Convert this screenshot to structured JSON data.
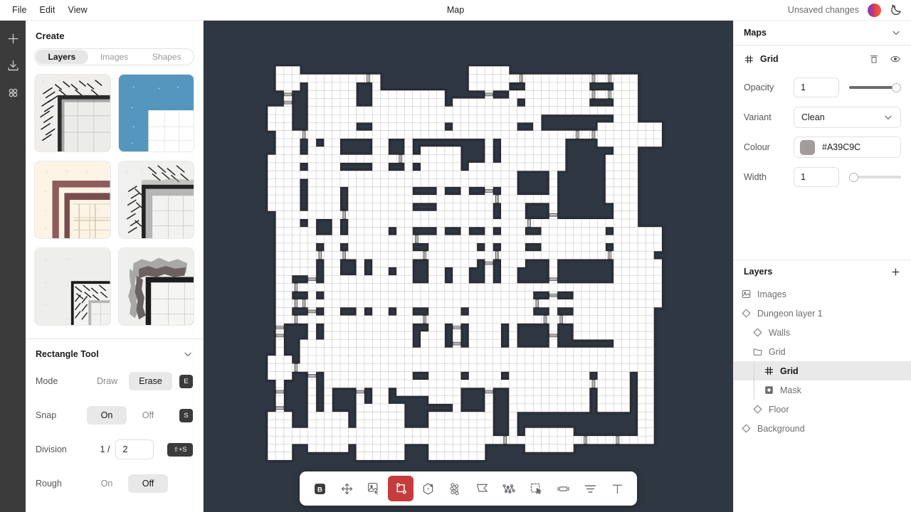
{
  "window": {
    "title": "Map",
    "menu": [
      "File",
      "Edit",
      "View"
    ],
    "status": "Unsaved changes",
    "avatar_name": "user-avatar",
    "theme_icon": "moon-star-icon"
  },
  "rail": {
    "items": [
      {
        "name": "add-icon",
        "label": "Add"
      },
      {
        "name": "download-icon",
        "label": "Download"
      },
      {
        "name": "apps-grid-icon",
        "label": "Apps"
      }
    ]
  },
  "create_panel": {
    "title": "Create",
    "tabs": [
      {
        "label": "Layers",
        "active": true
      },
      {
        "label": "Images",
        "active": false
      },
      {
        "label": "Shapes",
        "active": false
      }
    ],
    "thumbnails": [
      {
        "name": "thumb-hatched-stone",
        "selected": false
      },
      {
        "name": "thumb-blue-flat",
        "selected": true
      },
      {
        "name": "thumb-cream-brick",
        "selected": false
      },
      {
        "name": "thumb-hatched-grey",
        "selected": false
      },
      {
        "name": "thumb-woven-plank",
        "selected": false
      },
      {
        "name": "thumb-rough-cobble",
        "selected": false
      }
    ]
  },
  "rectangle_tool": {
    "title": "Rectangle Tool",
    "collapse_icon": "chevron-down-icon",
    "rows": [
      {
        "label": "Mode",
        "options": [
          "Draw",
          "Erase"
        ],
        "selected": "Erase",
        "shortcut": "E"
      },
      {
        "label": "Snap",
        "options": [
          "On",
          "Off"
        ],
        "selected": "On",
        "shortcut": "S"
      },
      {
        "label": "Rough",
        "options": [
          "On",
          "Off"
        ],
        "selected": "Off",
        "shortcut": ""
      }
    ],
    "division": {
      "label": "Division",
      "prefix": "1 /",
      "value": "2",
      "shortcut": "⇧+S"
    }
  },
  "toolbar": {
    "tools": [
      {
        "name": "brush-b-icon",
        "active": false,
        "dark": true
      },
      {
        "name": "move-arrows-icon",
        "active": false,
        "dark": false
      },
      {
        "name": "image-select-icon",
        "active": false,
        "dark": false
      },
      {
        "name": "rectangle-tool-icon",
        "active": true,
        "dark": false
      },
      {
        "name": "polygon-tool-icon",
        "active": false,
        "dark": false
      },
      {
        "name": "scatter-tool-icon",
        "active": false,
        "dark": false
      },
      {
        "name": "freehand-shape-icon",
        "active": false,
        "dark": false
      },
      {
        "name": "wall-path-icon",
        "active": false,
        "dark": false
      },
      {
        "name": "marquee-select-icon",
        "active": false,
        "dark": false
      },
      {
        "name": "door-tool-icon",
        "active": false,
        "dark": false
      },
      {
        "name": "layers-align-icon",
        "active": false,
        "dark": false
      },
      {
        "name": "text-tool-icon",
        "active": false,
        "dark": false
      }
    ]
  },
  "maps_panel": {
    "title": "Maps",
    "collapse_icon": "chevron-down-icon"
  },
  "grid_props": {
    "title": "Grid",
    "icon": "grid-hash-icon",
    "actions": [
      {
        "name": "delete-icon"
      },
      {
        "name": "visibility-eye-icon"
      }
    ],
    "opacity": {
      "label": "Opacity",
      "value": "1",
      "slider_percent": 100
    },
    "variant": {
      "label": "Variant",
      "value": "Clean"
    },
    "colour": {
      "label": "Colour",
      "value": "#A39C9C",
      "swatch": "#A39C9C"
    },
    "width": {
      "label": "Width",
      "value": "1",
      "slider_percent": 2
    }
  },
  "layers_panel": {
    "title": "Layers",
    "add_icon": "plus-icon",
    "items": [
      {
        "label": "Images",
        "icon": "image-icon",
        "indent": 1,
        "selected": false
      },
      {
        "label": "Dungeon layer 1",
        "icon": "diamond-icon",
        "indent": 1,
        "selected": false
      },
      {
        "label": "Walls",
        "icon": "diamond-icon",
        "indent": 2,
        "selected": false
      },
      {
        "label": "Grid",
        "icon": "folder-icon",
        "indent": 2,
        "selected": false
      },
      {
        "label": "Grid",
        "icon": "grid-hash-icon",
        "indent": 3,
        "selected": true
      },
      {
        "label": "Mask",
        "icon": "mask-icon",
        "indent": 3,
        "selected": false
      },
      {
        "label": "Floor",
        "icon": "diamond-icon",
        "indent": 2,
        "selected": false
      },
      {
        "label": "Background",
        "icon": "diamond-icon",
        "indent": 1,
        "selected": false
      }
    ]
  },
  "canvas": {
    "background": "#2F3742",
    "wall_colour": "#2B3039",
    "wall_outline": "#241c20",
    "floor_colour": "#FFFFFF",
    "grid_colour": "#A39C9C"
  }
}
